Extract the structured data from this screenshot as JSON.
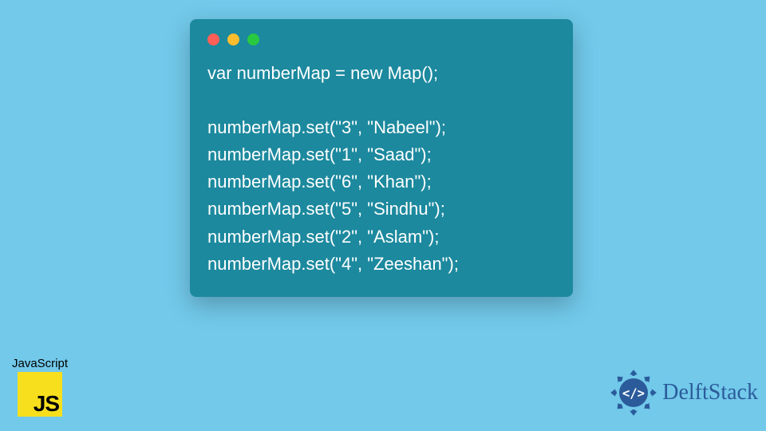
{
  "code": {
    "line1": "var numberMap = new Map();",
    "blank": "",
    "line2": "numberMap.set(\"3\", \"Nabeel\");",
    "line3": "numberMap.set(\"1\", \"Saad\");",
    "line4": "numberMap.set(\"6\", \"Khan\");",
    "line5": "numberMap.set(\"5\", \"Sindhu\");",
    "line6": "numberMap.set(\"2\", \"Aslam\");",
    "line7": "numberMap.set(\"4\", \"Zeeshan\");"
  },
  "js_badge": {
    "label": "JavaScript",
    "short": "JS"
  },
  "brand": {
    "name": "DelftStack"
  },
  "colors": {
    "bg": "#72c9ea",
    "window": "#1c899e",
    "js": "#f7df1e",
    "brand": "#2b5b9b"
  }
}
